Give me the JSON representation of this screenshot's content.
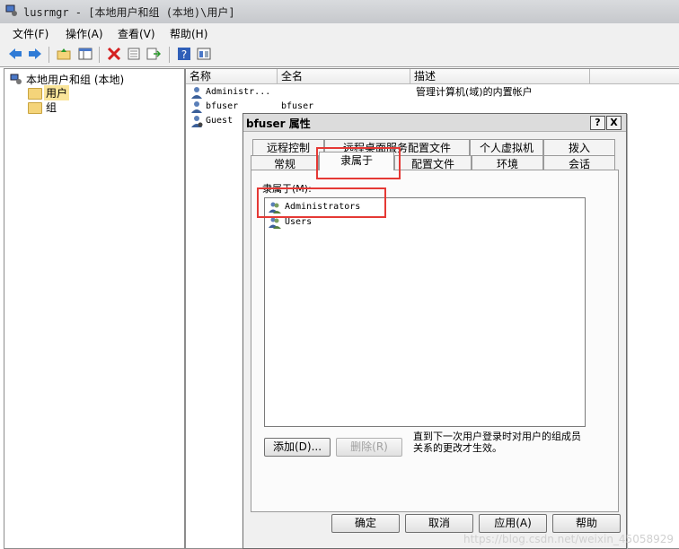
{
  "window": {
    "title": "lusrmgr - [本地用户和组 (本地)\\用户]"
  },
  "menu": [
    {
      "label": "文件(F)"
    },
    {
      "label": "操作(A)"
    },
    {
      "label": "查看(V)"
    },
    {
      "label": "帮助(H)"
    }
  ],
  "toolbar": {
    "icons": [
      "back-arrow",
      "forward-arrow",
      "up-folder",
      "show-hide-tree",
      "delete",
      "properties",
      "export-list",
      "help",
      "view"
    ]
  },
  "tree": {
    "root": "本地用户和组 (本地)",
    "children": [
      {
        "label": "用户",
        "selected": true
      },
      {
        "label": "组",
        "selected": false
      }
    ]
  },
  "list": {
    "columns": [
      "名称",
      "全名",
      "描述"
    ],
    "rows": [
      {
        "name": "Administr...",
        "fullname": "",
        "desc": "管理计算机(域)的内置帐户"
      },
      {
        "name": "bfuser",
        "fullname": "bfuser",
        "desc": ""
      },
      {
        "name": "Guest",
        "fullname": "",
        "desc": ""
      }
    ]
  },
  "dialog": {
    "title": "bfuser 属性",
    "help_btn": "?",
    "close_btn": "X",
    "tabs_back": [
      "远程控制",
      "远程桌面服务配置文件",
      "个人虚拟机",
      "拨入"
    ],
    "tabs_front": [
      "常规",
      "隶属于",
      "配置文件",
      "环境",
      "会话"
    ],
    "active_tab": "隶属于",
    "memberof_label": "隶属于(M):",
    "groups": [
      "Administrators",
      "Users"
    ],
    "add_btn": "添加(D)...",
    "remove_btn": "删除(R)",
    "note": "直到下一次用户登录时对用户的组成员关系的更改才生效。",
    "ok_btn": "确定",
    "cancel_btn": "取消",
    "apply_btn": "应用(A)",
    "help_btn2": "帮助"
  },
  "watermark": "https://blog.csdn.net/weixin_45058929",
  "colors": {
    "highlight": "#e53935",
    "selection": "#fae59a"
  }
}
